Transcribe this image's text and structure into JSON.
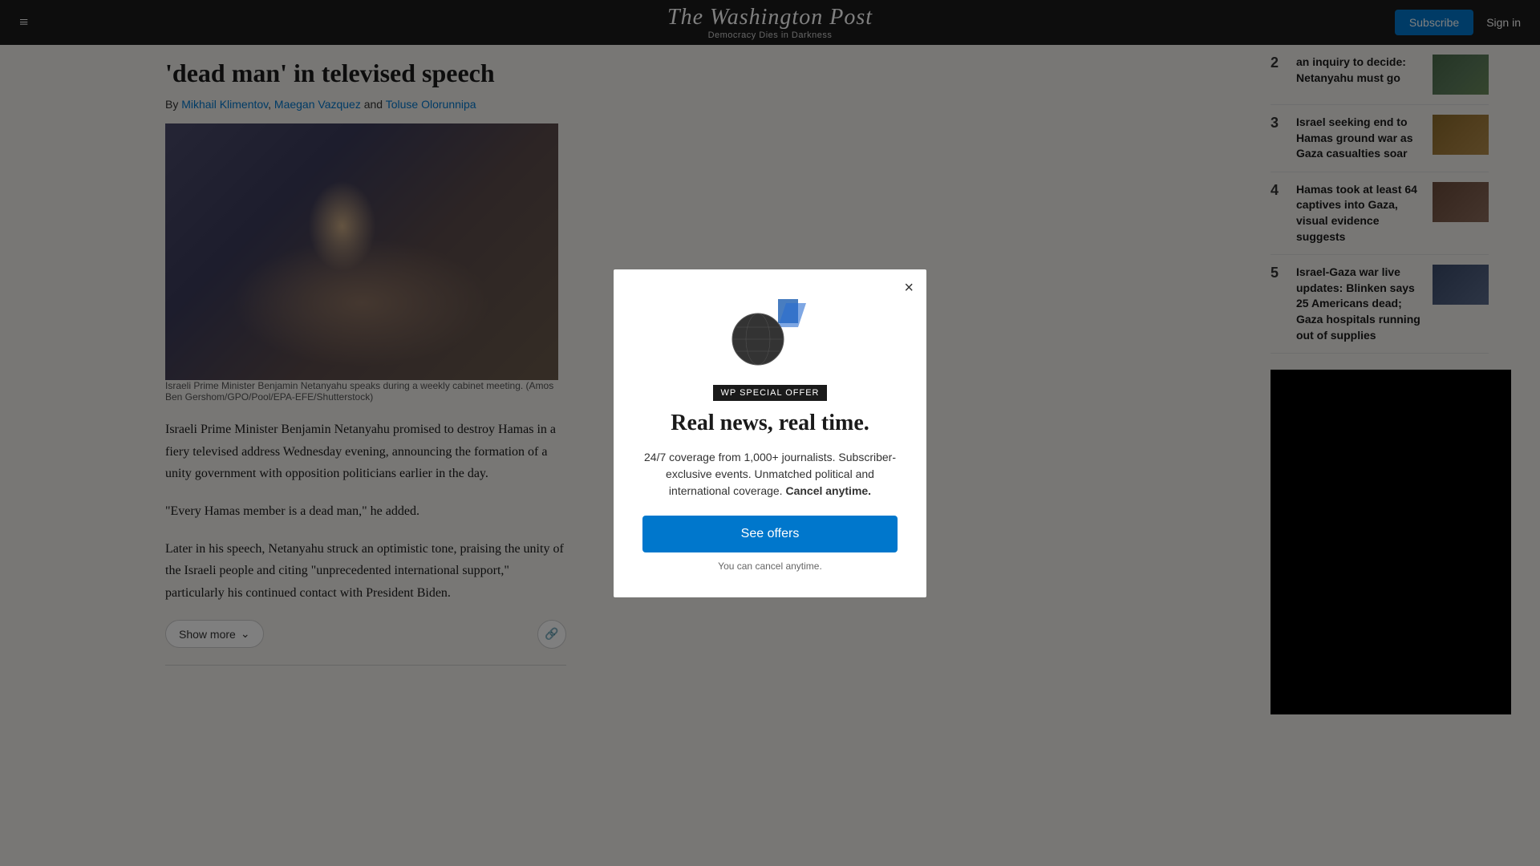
{
  "header": {
    "title": "The Washington Post",
    "tagline": "Democracy Dies in Darkness",
    "subscribe_label": "Subscribe",
    "sign_in_label": "Sign in",
    "menu_icon": "≡"
  },
  "article": {
    "title_partial": "'dead man' in televised speech",
    "byline_prefix": "By",
    "authors": [
      {
        "name": "Mikhail Klimentov",
        "link": "#"
      },
      {
        "name": "Maegan Vazquez",
        "link": "#"
      },
      {
        "name": "Toluse Olorunnipa",
        "link": "#"
      }
    ],
    "byline_conjunction": "and",
    "image_caption": "Israeli Prime Minister Benjamin Netanyahu speaks during a weekly cabinet meeting. (Amos Ben Gershom/GPO/Pool/EPA-EFE/Shutterstock)",
    "body": [
      "Israeli Prime Minister Benjamin Netanyahu promised to destroy Hamas in a fiery televised address Wednesday evening, announcing the formation of a unity government with opposition politicians earlier in the day.",
      "\"Every Hamas member is a dead man,\" he added.",
      "Later in his speech, Netanyahu struck an optimistic tone, praising the unity of the Israeli people and citing \"unprecedented international support,\" particularly his continued contact with President Biden."
    ],
    "show_more_label": "Show more",
    "share_icon": "🔗"
  },
  "sidebar": {
    "items": [
      {
        "number": "2",
        "headline": "an inquiry to decide: Netanyahu must go",
        "thumb_class": "thumb-2"
      },
      {
        "number": "3",
        "headline": "Israel seeking end to Hamas ground war as Gaza casualties soar",
        "thumb_class": "thumb-3"
      },
      {
        "number": "4",
        "headline": "Hamas took at least 64 captives into Gaza, visual evidence suggests",
        "thumb_class": "thumb-4"
      },
      {
        "number": "5",
        "headline": "Israel-Gaza war live updates: Blinken says 25 Americans dead; Gaza hospitals running out of supplies",
        "thumb_class": "thumb-5"
      }
    ]
  },
  "modal": {
    "badge": "WP SPECIAL OFFER",
    "headline": "Real news, real time.",
    "description_plain": "24/7 coverage from 1,000+ journalists. Subscriber-exclusive events. Unmatched political and international coverage.",
    "cancel_cta": "Cancel anytime.",
    "see_offers_label": "See offers",
    "cancel_note": "You can cancel anytime.",
    "close_icon": "×"
  }
}
